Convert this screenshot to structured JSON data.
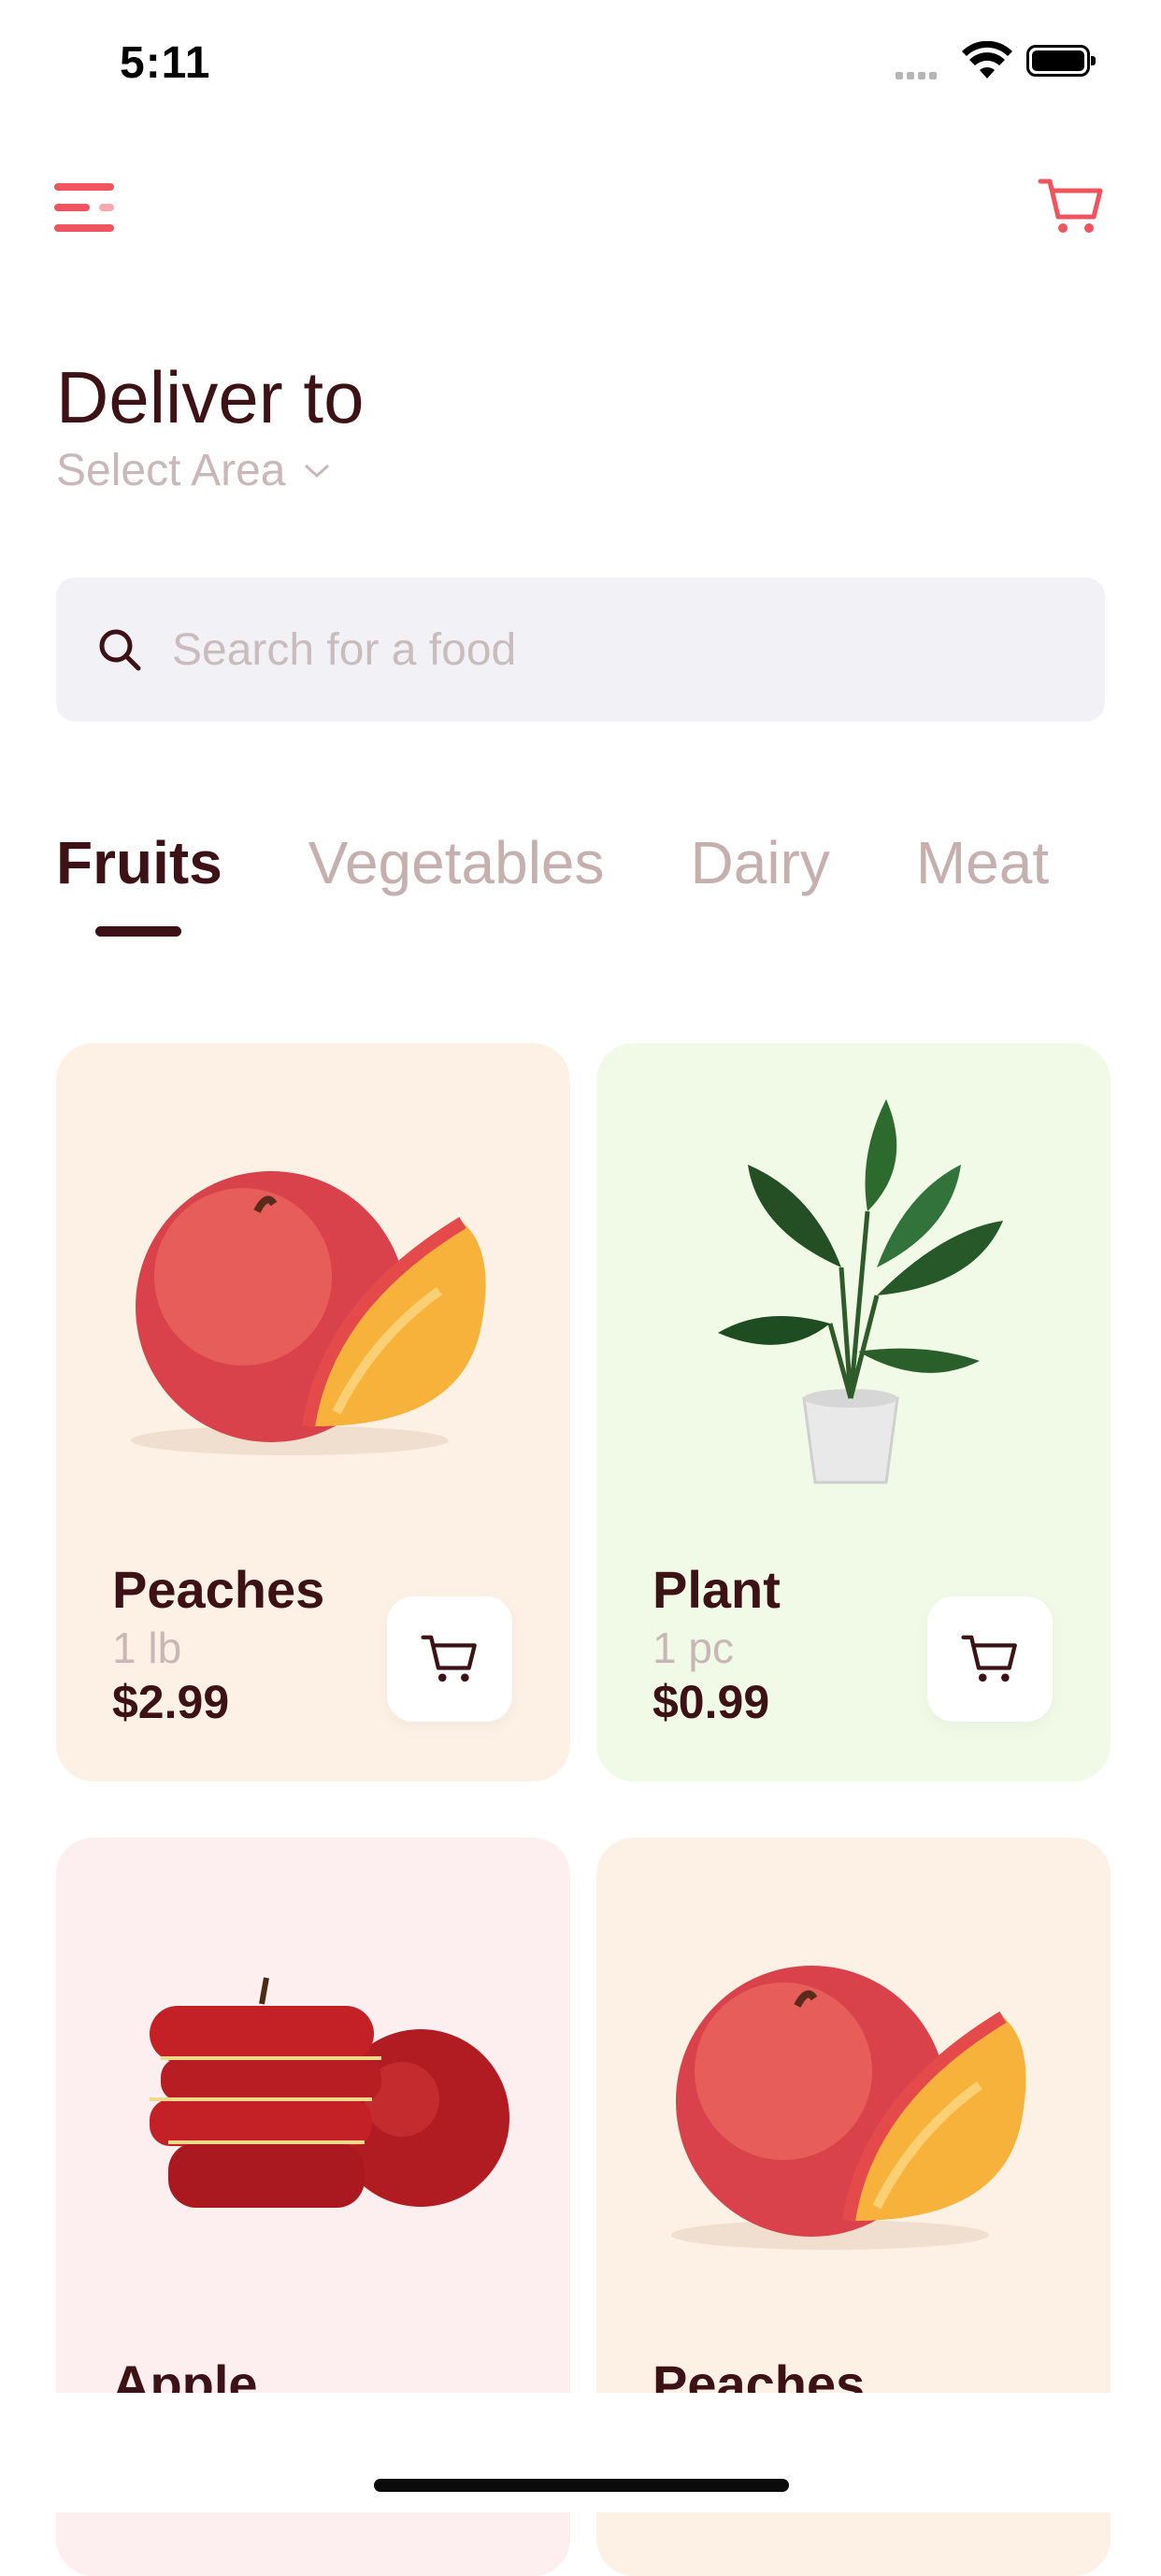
{
  "status_bar": {
    "time": "5:11"
  },
  "header": {
    "menu_icon": "menu-icon",
    "cart_icon": "cart-icon",
    "accent_color": "#f0555f"
  },
  "location": {
    "title": "Deliver to",
    "select_label": "Select Area"
  },
  "search": {
    "placeholder": "Search for a food",
    "value": ""
  },
  "tabs": [
    {
      "label": "Fruits",
      "active": true
    },
    {
      "label": "Vegetables",
      "active": false
    },
    {
      "label": "Dairy",
      "active": false
    },
    {
      "label": "Meat",
      "active": false
    }
  ],
  "products": [
    {
      "name": "Peaches",
      "unit": "1 lb",
      "price": "$2.99",
      "bg_color": "#fdf1e6",
      "image": "peach"
    },
    {
      "name": "Plant",
      "unit": "1 pc",
      "price": "$0.99",
      "bg_color": "#f1fae6",
      "image": "plant"
    },
    {
      "name": "Apple",
      "unit": "",
      "price": "",
      "bg_color": "#fdeef0",
      "image": "apple"
    },
    {
      "name": "Peaches",
      "unit": "",
      "price": "",
      "bg_color": "#fdf1e6",
      "image": "peach"
    }
  ],
  "colors": {
    "primary_text": "#3c1216",
    "muted_text": "#c9b8b9",
    "search_bg": "#f2f2f6"
  }
}
